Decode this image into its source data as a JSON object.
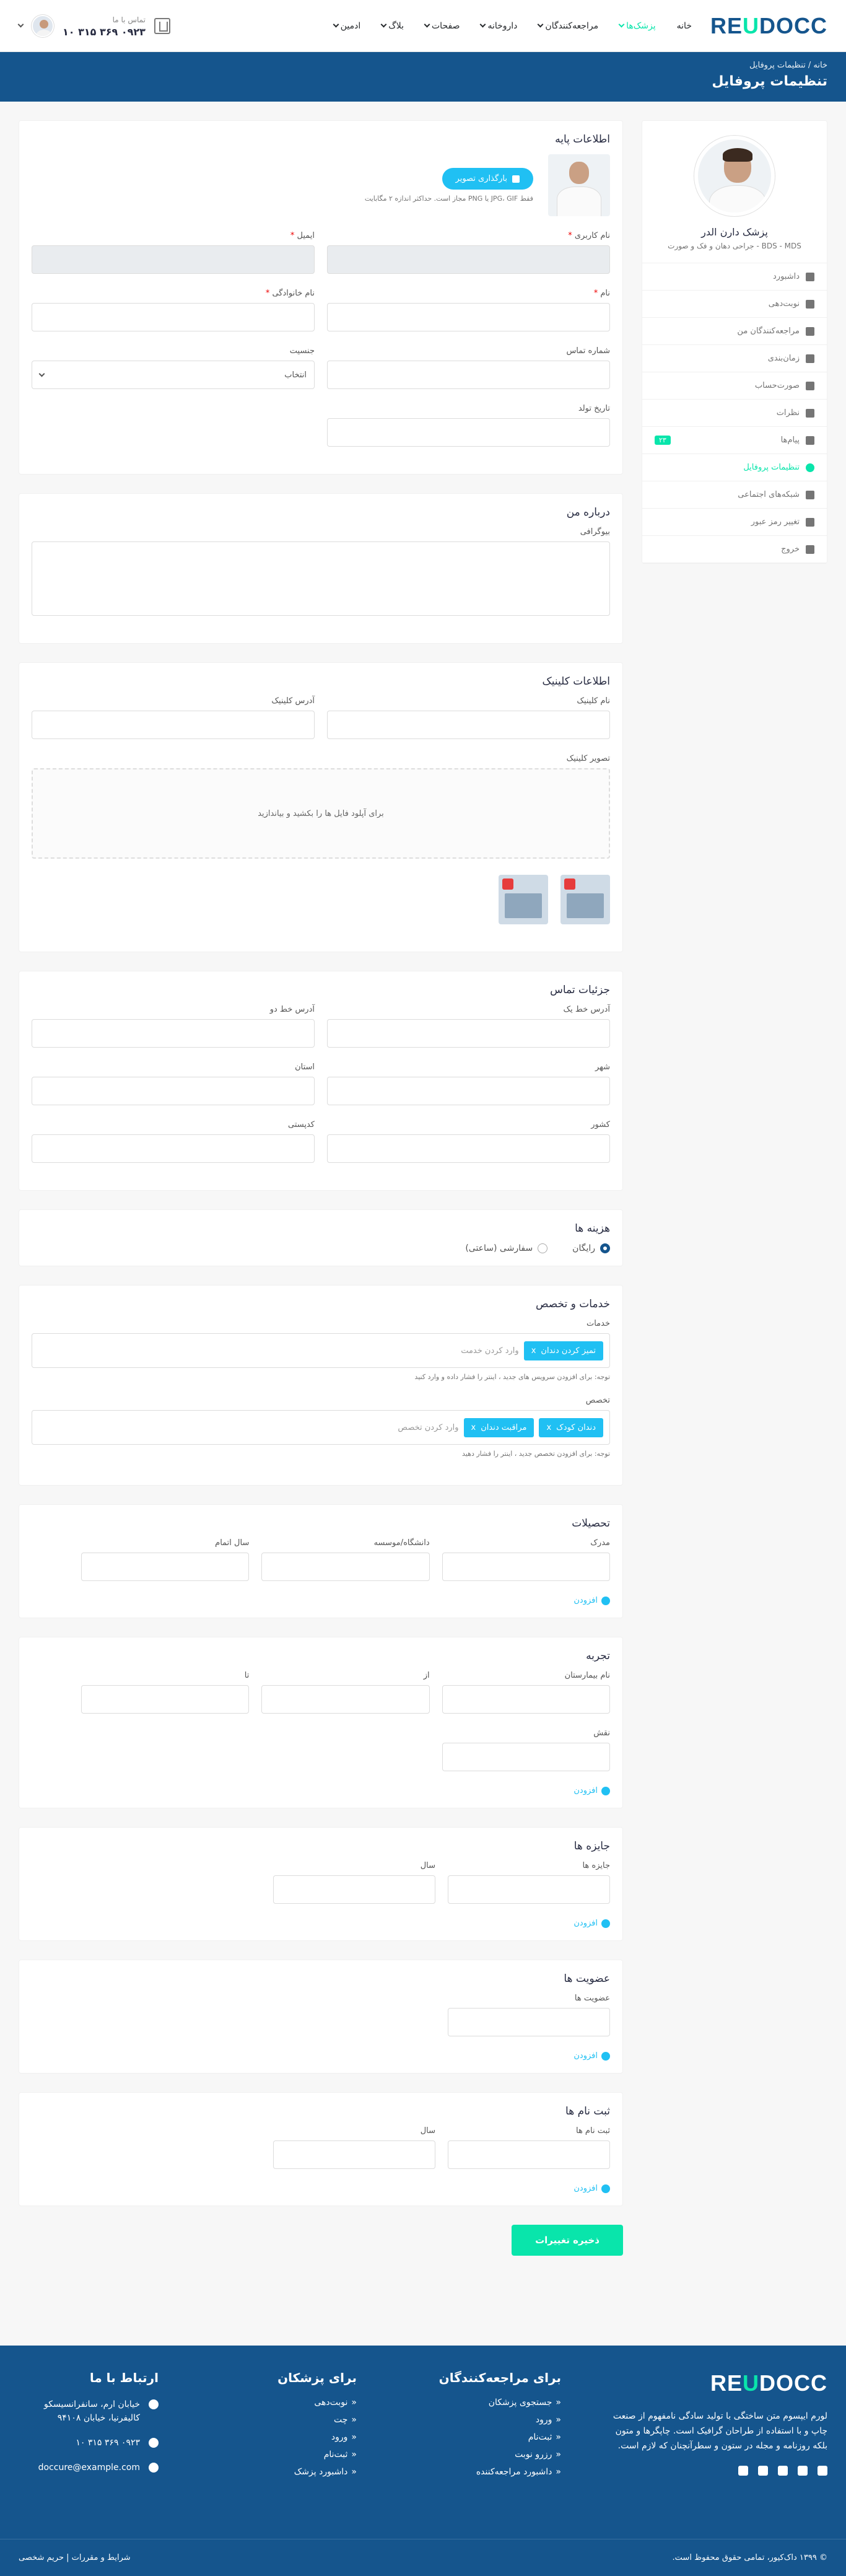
{
  "header": {
    "logo_main": "DOCC",
    "logo_accent": "U",
    "logo_end": "RE",
    "nav": [
      {
        "label": "خانه",
        "active": false,
        "caret": false
      },
      {
        "label": "پزشک‌ها",
        "active": true,
        "caret": true
      },
      {
        "label": "مراجعه‌کنندگان",
        "active": false,
        "caret": true
      },
      {
        "label": "داروخانه",
        "active": false,
        "caret": true
      },
      {
        "label": "صفحات",
        "active": false,
        "caret": true
      },
      {
        "label": "بلاگ",
        "active": false,
        "caret": true
      },
      {
        "label": "ادمین",
        "active": false,
        "caret": true
      }
    ],
    "contact_label": "تماس با ما",
    "contact_phone": "۰۹۲۳ ۳۶۹ ۳۱۵ ۱۰"
  },
  "breadcrumb": {
    "home": "خانه",
    "sep": "/",
    "current": "تنظیمات پروفایل",
    "title": "تنظیمات پروفایل"
  },
  "sidebar": {
    "name": "پزشک دارن الدر",
    "desc": "BDS - MDS - جراحی دهان و فک و صورت",
    "items": [
      {
        "label": "داشبورد",
        "icon": "dashboard-icon"
      },
      {
        "label": "نوبت‌دهی",
        "icon": "calendar-icon"
      },
      {
        "label": "مراجعه‌کنندگان من",
        "icon": "user-icon"
      },
      {
        "label": "زمان‌بندی",
        "icon": "hourglass-icon"
      },
      {
        "label": "صورت‌حساب",
        "icon": "invoice-icon"
      },
      {
        "label": "نظرات",
        "icon": "star-icon"
      },
      {
        "label": "پیام‌ها",
        "icon": "chat-icon",
        "badge": "۲۳"
      },
      {
        "label": "تنظیمات پروفایل",
        "icon": "user-cog-icon",
        "active": true
      },
      {
        "label": "شبکه‌های اجتماعی",
        "icon": "share-icon"
      },
      {
        "label": "تغییر رمز عبور",
        "icon": "lock-icon"
      },
      {
        "label": "خروج",
        "icon": "logout-icon"
      }
    ]
  },
  "basic": {
    "title": "اطلاعات پایه",
    "upload": "بارگذاری تصویر",
    "upload_hint": "فقط JPG، GIF یا PNG مجاز است. حداکثر اندازه ۲ مگابایت",
    "username": "نام کاربری",
    "email": "ایمیل",
    "firstname": "نام",
    "lastname": "نام خانوادگی",
    "phone": "شماره تماس",
    "gender": "جنسیت",
    "gender_value": "انتخاب",
    "dob": "تاریخ تولد"
  },
  "about": {
    "title": "درباره من",
    "bio": "بیوگرافی"
  },
  "clinic": {
    "title": "اطلاعات کلینیک",
    "name": "نام کلینیک",
    "address": "آدرس کلینیک",
    "images": "تصویر کلینیک",
    "drop": "برای آپلود فایل ها را بکشید و بیاندازید"
  },
  "contact": {
    "title": "جزئیات تماس",
    "addr1": "آدرس خط یک",
    "addr2": "آدرس خط دو",
    "city": "شهر",
    "state": "استان",
    "country": "کشور",
    "postal": "کدپستی"
  },
  "pricing": {
    "title": "هزینه ها",
    "free": "رایگان",
    "custom": "سفارشی (ساعتی)"
  },
  "services": {
    "title": "خدمات و تخصص",
    "services_label": "خدمات",
    "services_tags": [
      "تمیز کردن دندان"
    ],
    "services_ph": "وارد کردن خدمت",
    "services_note": "توجه: برای افزودن سرویس های جدید ، اینتر را فشار داده و وارد کنید",
    "spec_label": "تخصص",
    "spec_tags": [
      "دندان کودک",
      "مراقبت دندان"
    ],
    "spec_ph": "وارد کردن تخصص",
    "spec_note": "توجه: برای افزودن تخصص جدید ، اینتر را فشار دهید"
  },
  "education": {
    "title": "تحصیلات",
    "degree": "مدرک",
    "college": "دانشگاه/موسسه",
    "year": "سال اتمام",
    "add": "افزودن"
  },
  "experience": {
    "title": "تجربه",
    "hospital": "نام بیمارستان",
    "from": "از",
    "to": "تا",
    "designation": "نقش",
    "add": "افزودن"
  },
  "awards": {
    "title": "جایزه ها",
    "award": "جایزه ها",
    "year": "سال",
    "add": "افزودن"
  },
  "memberships": {
    "title": "عضویت ها",
    "label": "عضویت ها",
    "add": "افزودن"
  },
  "registrations": {
    "title": "ثبت نام ها",
    "label": "ثبت نام ها",
    "year": "سال",
    "add": "افزودن"
  },
  "save": "ذخیره تغییرات",
  "footer": {
    "about": "لورم ایپسوم متن ساختگی با تولید سادگی نامفهوم از صنعت چاپ و با استفاده از طراحان گرافیک است. چاپگرها و متون بلکه روزنامه و مجله در ستون و سطرآنچنان که لازم است.",
    "patients_title": "برای مراجعه‌کنندگان",
    "patients": [
      "جستجوی پزشکان",
      "ورود",
      "ثبت‌نام",
      "رزرو نوبت",
      "داشبورد مراجعه‌کننده"
    ],
    "doctors_title": "برای پزشکان",
    "doctors": [
      "نوبت‌دهی",
      "چت",
      "ورود",
      "ثبت‌نام",
      "داشبورد پزشک"
    ],
    "contact_title": "ارتباط با ما",
    "address": "خیابان ارم، سانفرانسیسکو کالیفرنیا، خیابان ۹۴۱۰۸",
    "phone": "۰۹۲۳ ۳۶۹ ۳۱۵ ۱۰",
    "email": "doccure@example.com",
    "copyright": "© ۱۳۹۹ داک‌کیور، تمامی حقوق محفوظ است.",
    "terms": "شرایط و مقررات",
    "privacy": "حریم شخصی"
  }
}
